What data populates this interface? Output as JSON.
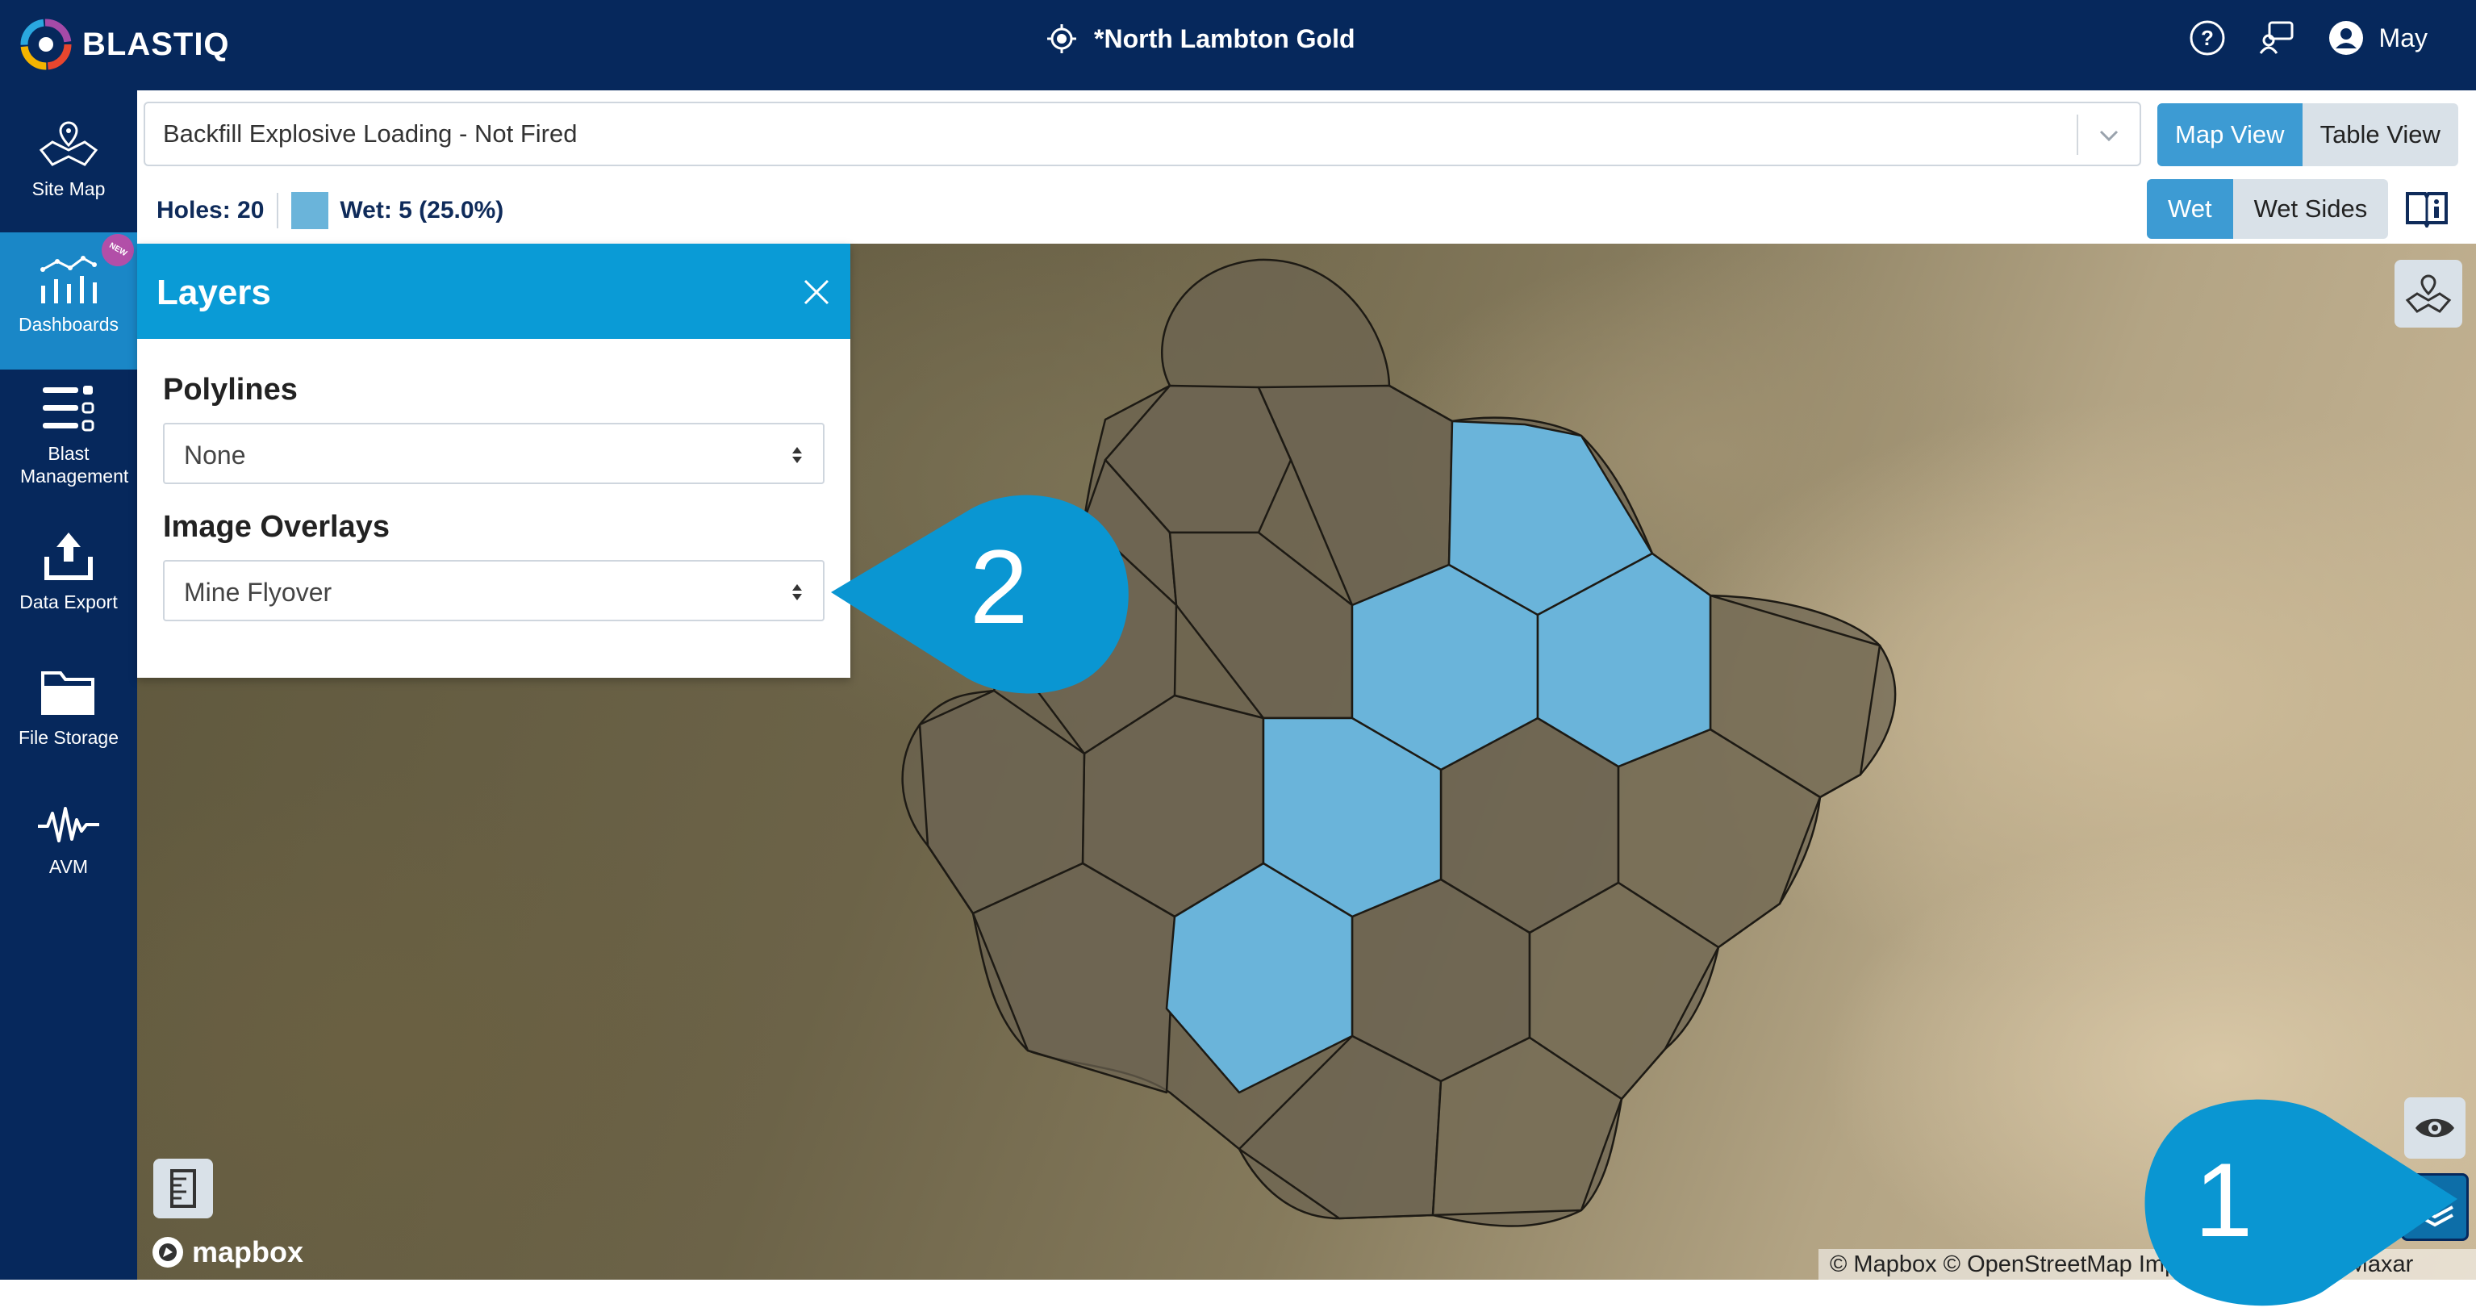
{
  "app": {
    "logo_text": "BLASTIQ",
    "site_name": "*North Lambton Gold",
    "user_name": "May"
  },
  "header_icons": [
    "help-icon",
    "support-chat-icon",
    "user-avatar-icon"
  ],
  "sidebar": {
    "items": [
      {
        "label": "Site Map",
        "icon": "site-map-icon"
      },
      {
        "label": "Dashboards",
        "icon": "dashboards-icon",
        "badge": "NEW",
        "active": true
      },
      {
        "label": "Blast Management",
        "icon": "blast-management-icon"
      },
      {
        "label": "Data Export",
        "icon": "data-export-icon"
      },
      {
        "label": "File Storage",
        "icon": "file-storage-icon"
      },
      {
        "label": "AVM",
        "icon": "avm-icon"
      }
    ]
  },
  "toolbar": {
    "dataset_select": "Backfill Explosive Loading - Not Fired",
    "view_toggle": {
      "map_view": "Map View",
      "table_view": "Table View",
      "selected": "Map View"
    },
    "holes_label": "Holes: 20",
    "wet_label": "Wet: 5 (25.0%)",
    "wet_toggle": {
      "wet": "Wet",
      "wet_sides": "Wet Sides",
      "selected": "Wet"
    }
  },
  "layers_panel": {
    "title": "Layers",
    "polylines_label": "Polylines",
    "polylines_value": "None",
    "image_overlays_label": "Image Overlays",
    "image_overlays_value": "Mine Flyover"
  },
  "map": {
    "attribution": "© Mapbox © OpenStreetMap Improve this map © Maxar",
    "mapbox_logo": "mapbox",
    "controls": [
      "site-map-toggle-icon",
      "visibility-icon",
      "layers-icon",
      "legend-ruler-icon"
    ],
    "hole_counts": {
      "total": 20,
      "wet": 5
    }
  },
  "callouts": {
    "first": "1",
    "second": "2"
  },
  "colors": {
    "header": "#06285c",
    "accent": "#0a9bd6",
    "wet_fill": "#6ab4da",
    "dry_fill": "#6b6350"
  }
}
